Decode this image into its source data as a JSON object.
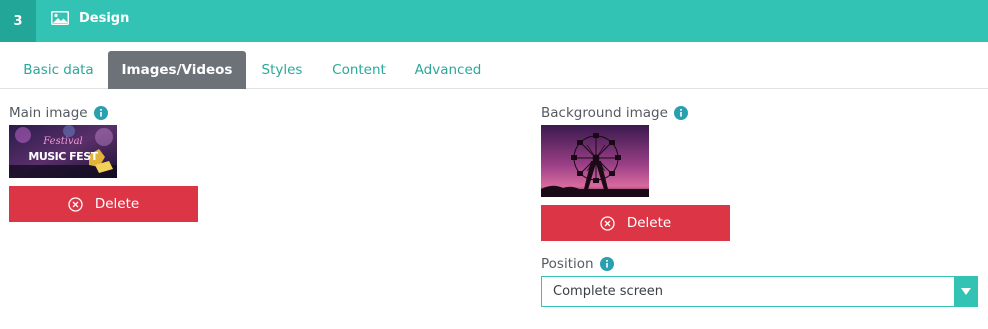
{
  "header": {
    "step_number": "3",
    "title": "Design",
    "icon": "image-icon"
  },
  "tabs": [
    {
      "label": "Basic data",
      "active": false
    },
    {
      "label": "Images/Videos",
      "active": true
    },
    {
      "label": "Styles",
      "active": false
    },
    {
      "label": "Content",
      "active": false
    },
    {
      "label": "Advanced",
      "active": false
    }
  ],
  "main_image": {
    "label": "Main image",
    "thumb_title_line1": "Festival",
    "thumb_title_line2": "MUSIC FEST",
    "delete_label": "Delete"
  },
  "background_image": {
    "label": "Background image",
    "delete_label": "Delete"
  },
  "position": {
    "label": "Position",
    "selected": "Complete screen"
  },
  "colors": {
    "accent": "#33c3b4",
    "accent_dark": "#21a698",
    "danger": "#dc3545",
    "tab_active": "#6d7279"
  }
}
